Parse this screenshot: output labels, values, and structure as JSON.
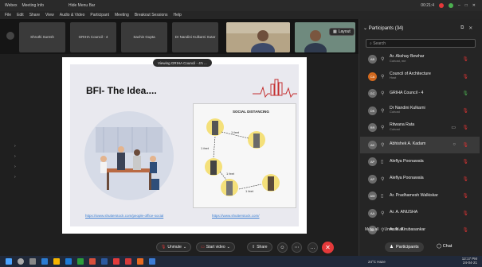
{
  "titlebar": {
    "app": "Webex",
    "meeting": "Meeting Info",
    "hide_menu": "Hide Menu Bar",
    "clock": "00:21:4"
  },
  "menu": [
    "File",
    "Edit",
    "Share",
    "View",
    "Audio & Video",
    "Participant",
    "Meeting",
    "Breakout Sessions",
    "Help"
  ],
  "video_strip": [
    {
      "label": "Shruthi Suresh"
    },
    {
      "label": "GRIHA Council - 4"
    },
    {
      "label": "Sachin Gupta"
    },
    {
      "label": "Dr Nandini Kulkarni Sutar"
    }
  ],
  "layout_label": "Layout",
  "viewing_label": "Viewing GRIHA Council - 4's ...",
  "slide": {
    "title": "BFI- The Idea....",
    "social_title": "SOCIAL DISTANCING",
    "link_left": "https://www.shutterstock.com/people-office-social",
    "link_right": "https://www.shutterstock.com/",
    "distance_labels": [
      "1 feet",
      "1 feet",
      "1 feet",
      "1 feet"
    ]
  },
  "toolbar": {
    "unmute": "Unmute",
    "start_video": "Start video",
    "share": "Share",
    "participants": "Participants",
    "chat": "Chat"
  },
  "panel": {
    "title": "Participants (34)",
    "search_placeholder": "Search",
    "mute_all": "Mute all",
    "unmute_all": "Unmute all",
    "participants": [
      {
        "initials": "AB",
        "name": "Ar. Akshay Bewhar",
        "sub": "Cohost, me",
        "mic": "muted"
      },
      {
        "initials": "CA",
        "name": "Council of Architecture",
        "sub": "Host",
        "mic": "muted"
      },
      {
        "initials": "GC",
        "name": "GRIHA Council - 4",
        "sub": "",
        "mic": "on"
      },
      {
        "initials": "DK",
        "name": "Dr Nandini Kulkarni",
        "sub": "Cohost",
        "mic": "muted"
      },
      {
        "initials": "RR",
        "name": "Ritwana Rata",
        "sub": "Cohost",
        "mic": "muted"
      },
      {
        "initials": "AK",
        "name": "Abhishek A. Kadam",
        "sub": "",
        "mic": "muted"
      },
      {
        "initials": "AP",
        "name": "Aleflya Poonawala",
        "sub": "",
        "mic": "muted"
      },
      {
        "initials": "AP",
        "name": "Aleflya Poonawala",
        "sub": "",
        "mic": "muted"
      },
      {
        "initials": "AW",
        "name": "Ar. Pradhamesh Walkiskar",
        "sub": "",
        "mic": "muted"
      },
      {
        "initials": "AA",
        "name": "Ar. A. ANUSHA",
        "sub": "",
        "mic": "muted"
      },
      {
        "initials": "AK",
        "name": "Ar. N. Kirubasankar",
        "sub": "",
        "mic": "muted"
      }
    ]
  },
  "taskbar": {
    "weather": "24°C Haze",
    "time": "12:17 PM",
    "date": "24-04-21"
  },
  "colors": {
    "accent": "#e4393a",
    "link": "#3c7fd2",
    "mic_muted": "#d33333",
    "mic_on": "#4caf50"
  }
}
